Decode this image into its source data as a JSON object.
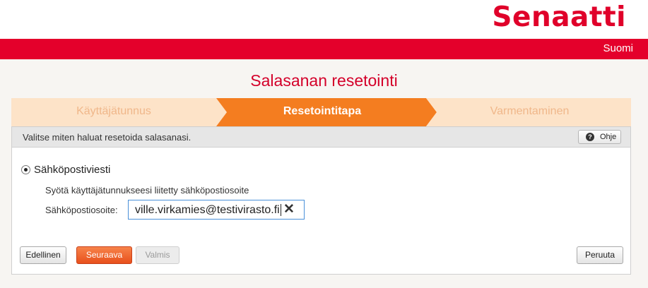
{
  "header": {
    "logo_text": "Senaatti",
    "language": "Suomi",
    "brand_color": "#e4002b"
  },
  "page": {
    "title": "Salasanan resetointi"
  },
  "wizard": {
    "steps": [
      {
        "label": "Käyttäjätunnus",
        "state": "completed"
      },
      {
        "label": "Resetointitapa",
        "state": "active"
      },
      {
        "label": "Varmentaminen",
        "state": "upcoming"
      }
    ],
    "active_color": "#f47d20",
    "inactive_color": "#fde3c8"
  },
  "panel": {
    "instruction": "Valitse miten haluat resetoida salasanasi.",
    "help_label": "Ohje",
    "help_icon": "question-icon"
  },
  "method": {
    "option_label": "Sähköpostiviesti",
    "selected": true,
    "hint": "Syötä käyttäjätunnukseesi liitetty sähköpostiosoite",
    "email_label": "Sähköpostiosoite:",
    "email_value": "ville.virkamies@testivirasto.fi",
    "clear_icon": "close-icon"
  },
  "buttons": {
    "previous": "Edellinen",
    "next": "Seuraava",
    "done": "Valmis",
    "cancel": "Peruuta"
  }
}
